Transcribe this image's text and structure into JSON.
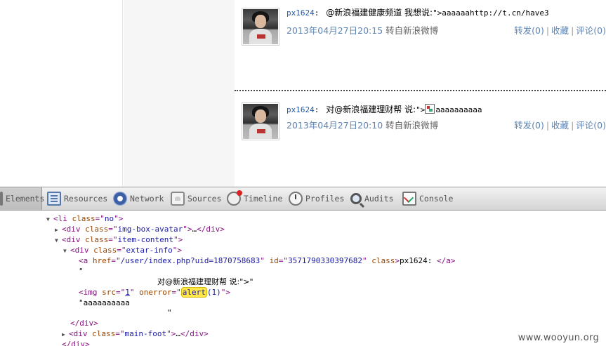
{
  "posts": [
    {
      "user": "px1624",
      "colon": ":",
      "text_before": "@新浪福建健康频道 我想说:",
      "text_code": "\">aaaaaahttp://t.cn/have3",
      "time": "2013年04月27日20:15",
      "via": "转自新浪微博",
      "actions": {
        "forward": "转发(0)",
        "favorite": "收藏",
        "comment": "评论(0)",
        "separator": "|"
      }
    },
    {
      "user": "px1624",
      "colon": ":",
      "text_before": "对@新浪福建理财帮 说:",
      "text_code": "\">",
      "text_after": "aaaaaaaaaa",
      "time": "2013年04月27日20:10",
      "via": "转自新浪微博",
      "actions": {
        "forward": "转发(0)",
        "favorite": "收藏",
        "comment": "评论(0)",
        "separator": "|"
      }
    }
  ],
  "devtools": {
    "tabs": [
      {
        "label": "Elements",
        "icon": "elements-icon",
        "selected": true
      },
      {
        "label": "Resources",
        "icon": "resources-icon"
      },
      {
        "label": "Network",
        "icon": "network-icon"
      },
      {
        "label": "Sources",
        "icon": "sources-icon"
      },
      {
        "label": "Timeline",
        "icon": "timeline-icon"
      },
      {
        "label": "Profiles",
        "icon": "profiles-icon"
      },
      {
        "label": "Audits",
        "icon": "audits-icon"
      },
      {
        "label": "Console",
        "icon": "console-icon"
      }
    ],
    "tree": {
      "li_tag": "li",
      "li_attr": "class",
      "li_val": "no",
      "avatar_tag": "div",
      "avatar_attr": "class",
      "avatar_val": "img-box-avatar",
      "collapsed": "…",
      "item_tag": "div",
      "item_attr": "class",
      "item_val": "item-content",
      "extar_tag": "div",
      "extar_attr": "class",
      "extar_val": "extar-info",
      "a_tag": "a",
      "a_href_attr": "href",
      "a_href_val": "/user/index.php?uid=1870758683",
      "a_id_attr": "id",
      "a_id_val": "3571790330397682",
      "a_class_attr": "class",
      "a_text": "px1624: ",
      "quote_open": "\"",
      "cjk_text": "对@新浪福建理财帮 说:\">\"",
      "img_tag": "img",
      "img_src_attr": "src",
      "img_src_val": "1",
      "img_onerror_attr": "onerror",
      "img_onerror_hl": "alert",
      "img_onerror_rest": "(1)",
      "aaa_text": "\"aaaaaaaaaa",
      "quote_close": "\"",
      "close_div": "/div",
      "foot_tag": "div",
      "foot_attr": "class",
      "foot_val": "main-foot"
    }
  },
  "watermark": "www.wooyun.org"
}
